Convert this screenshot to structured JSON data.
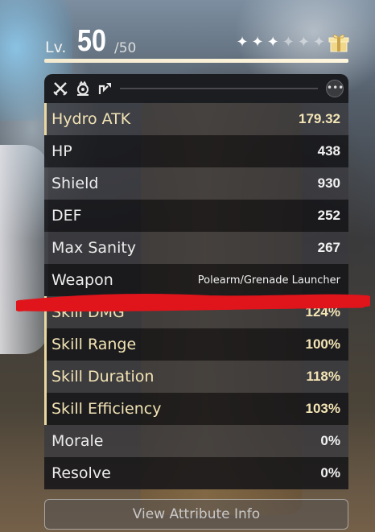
{
  "level": {
    "label": "Lv.",
    "value": "50",
    "max": "/50"
  },
  "stars": {
    "filled": 3,
    "total": 6
  },
  "icons": {
    "tabs": [
      "crossed-swords-icon",
      "sanity-emblem-icon",
      "arrow-badge-icon"
    ],
    "more": "more-icon",
    "gift": "gift-icon"
  },
  "attributes": [
    {
      "label": "Hydro ATK",
      "value": "179.32",
      "highlight": true
    },
    {
      "label": "HP",
      "value": "438",
      "highlight": false
    },
    {
      "label": "Shield",
      "value": "930",
      "highlight": false
    },
    {
      "label": "DEF",
      "value": "252",
      "highlight": false
    },
    {
      "label": "Max Sanity",
      "value": "267",
      "highlight": false
    },
    {
      "label": "Weapon",
      "value": "Polearm/Grenade Launcher",
      "highlight": false
    },
    {
      "label": "Skill DMG",
      "value": "124%",
      "highlight": true
    },
    {
      "label": "Skill Range",
      "value": "100%",
      "highlight": true
    },
    {
      "label": "Skill Duration",
      "value": "118%",
      "highlight": true
    },
    {
      "label": "Skill Efficiency",
      "value": "103%",
      "highlight": true
    },
    {
      "label": "Morale",
      "value": "0%",
      "highlight": false
    },
    {
      "label": "Resolve",
      "value": "0%",
      "highlight": false
    }
  ],
  "view_button": "View Attribute Info",
  "colors": {
    "highlight": "#f3e4b5",
    "redaction": "#e0141b"
  }
}
